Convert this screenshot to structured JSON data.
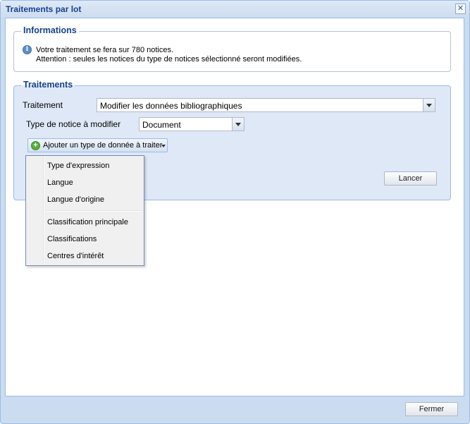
{
  "window": {
    "title": "Traitements par lot",
    "close_glyph": "✕"
  },
  "informations": {
    "legend": "Informations",
    "line1": "Votre traitement se fera sur 780 notices.",
    "line2": "Attention : seules les notices du type de notices sélectionné seront modifiées."
  },
  "traitements": {
    "legend": "Traitements",
    "traitement_label": "Traitement",
    "traitement_value": "Modifier les données bibliographiques",
    "type_label": "Type de notice à modifier",
    "type_value": "Document",
    "add_button": "Ajouter un type de donnée à traiter",
    "lancer": "Lancer"
  },
  "menu": {
    "items": [
      "Type d'expression",
      "Langue",
      "Langue d'origine",
      "Classification principale",
      "Classifications",
      "Centres d'intérêt"
    ]
  },
  "footer": {
    "fermer": "Fermer"
  },
  "icons": {
    "info": "info-icon",
    "add": "add-icon",
    "close": "close-icon",
    "dropdown": "chevron-down-icon"
  }
}
